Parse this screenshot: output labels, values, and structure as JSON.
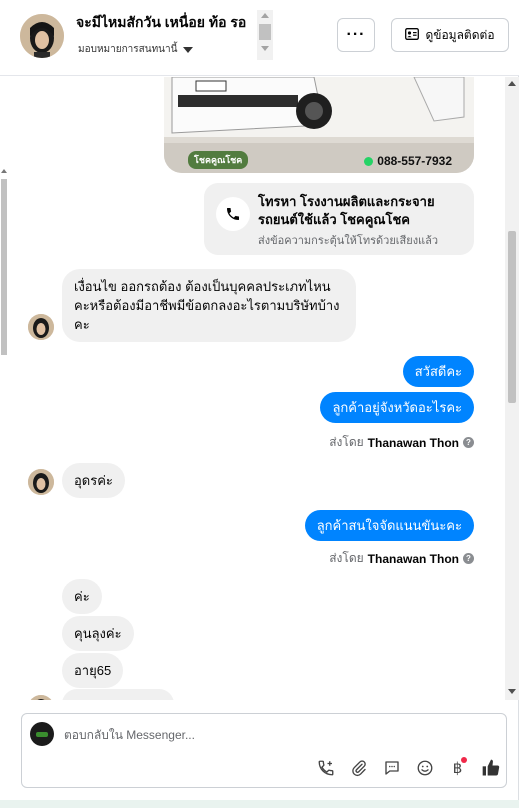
{
  "header": {
    "name": "จะมีไหมสักวัน เหนื่อย ท้อ รอ",
    "subtitle": "มอบหมายการสนทนานี้",
    "more_label": "···",
    "contact_label": "ดูข้อมูลติดต่อ"
  },
  "photo": {
    "phone": "088-557-7932",
    "brand": "โชคคูณโชค"
  },
  "call_card": {
    "title": "โทรหา โรงงานผลิตและกระจายรถยนต์ใช้แล้ว โชคคูณโชค",
    "subtitle": "ส่งข้อความกระตุ้นให้โทรด้วยเสียงแล้ว"
  },
  "messages": {
    "in_1": "เงื่อนไข ออกรถต้อง ต้องเป็นบุคคลประเภทไหนคะหรือต้องมีอาชีพมีข้อตกลงอะไรตามบริษัทบ้างคะ",
    "out_1": "สวัสดีคะ",
    "out_2": "ลูกค้าอยู่จังหวัดอะไรคะ",
    "sent_by_prefix": "ส่งโดย",
    "sent_by_name": "Thanawan Thon",
    "in_2": "อุดรค่ะ",
    "out_3": "ลูกค้าสนใจจัดแนนขันะคะ",
    "in_3": "ค่ะ",
    "in_4": "คุนลุงค่ะ",
    "in_5": "อายุ65"
  },
  "composer": {
    "placeholder": "ตอบกลับใน Messenger..."
  },
  "icons": {
    "more": "more-dots-icon",
    "contact": "contact-card-icon",
    "call": "phone-icon",
    "tools": [
      "call-add-icon",
      "attach-icon",
      "saved-reply-icon",
      "emoji-icon",
      "baht-icon",
      "like-icon"
    ]
  },
  "colors": {
    "outgoing": "#0084ff",
    "incoming": "#f0f0f0",
    "badge": "#f02849"
  }
}
